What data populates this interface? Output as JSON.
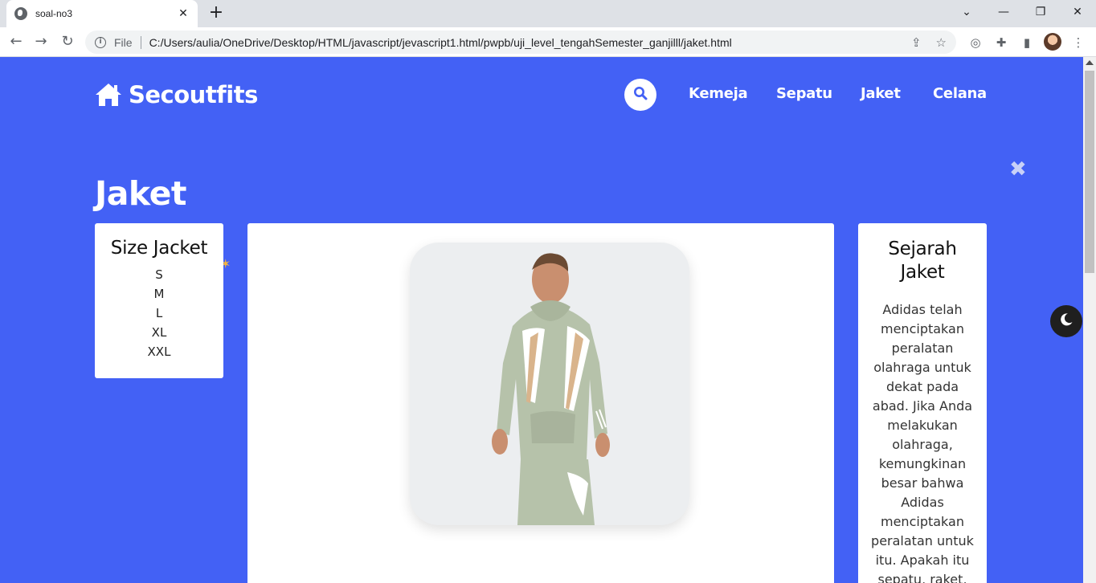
{
  "browser": {
    "tab_title": "soal-no3",
    "tab_close": "✕",
    "new_tab": "+",
    "address_label": "File",
    "url": "C:/Users/aulia/OneDrive/Desktop/HTML/javascript/jevascript1.html/pwpb/uji_level_tengahSemester_ganjilll/jaket.html"
  },
  "site": {
    "brand": "Secoutfits",
    "nav": [
      "Kemeja",
      "Sepatu",
      "Jaket",
      "Celana"
    ]
  },
  "page": {
    "title": "Jaket",
    "close_symbol": "✖"
  },
  "sizes": {
    "title": "Size Jacket",
    "items": [
      "S",
      "M",
      "L",
      "XL",
      "XXL"
    ]
  },
  "history": {
    "title": "Sejarah Jaket",
    "text": "Adidas telah menciptakan peralatan olahraga untuk dekat pada abad. Jika Anda melakukan olahraga, kemungkinan besar bahwa Adidas menciptakan peralatan untuk itu. Apakah itu sepatu, raket,"
  },
  "colors": {
    "accent": "#4361f5",
    "card": "#ffffff",
    "dark_toggle": "#1f1f1f"
  }
}
